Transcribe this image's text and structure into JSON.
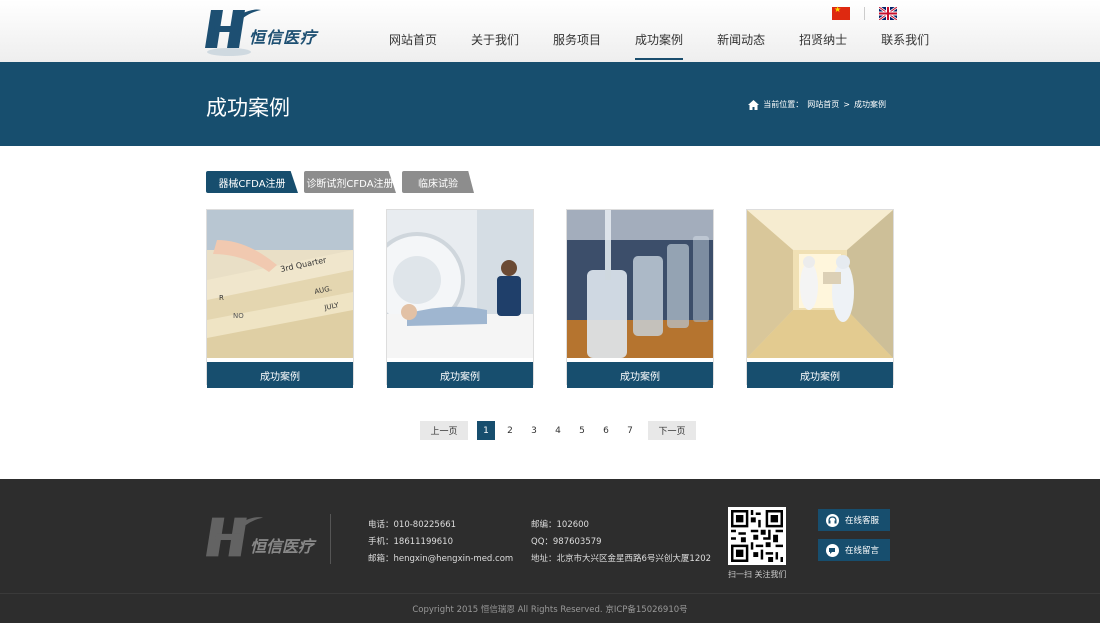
{
  "header": {
    "logo_text": "恒信医疗",
    "nav": [
      {
        "label": "网站首页"
      },
      {
        "label": "关于我们"
      },
      {
        "label": "服务项目"
      },
      {
        "label": "成功案例"
      },
      {
        "label": "新闻动态"
      },
      {
        "label": "招贤纳士"
      },
      {
        "label": "联系我们"
      }
    ],
    "active_nav": "成功案例"
  },
  "banner": {
    "title": "成功案例",
    "breadcrumb_prefix": "当前位置：",
    "breadcrumb_home": "网站首页",
    "breadcrumb_sep": ">",
    "breadcrumb_current": "成功案例"
  },
  "tabs": [
    {
      "label": "器械CFDA注册"
    },
    {
      "label": "诊断试剂CFDA注册"
    },
    {
      "label": "临床试验"
    }
  ],
  "cards": [
    {
      "caption": "成功案例"
    },
    {
      "caption": "成功案例"
    },
    {
      "caption": "成功案例"
    },
    {
      "caption": "成功案例"
    }
  ],
  "pager": {
    "prev": "上一页",
    "next": "下一页",
    "pages": [
      "1",
      "2",
      "3",
      "4",
      "5",
      "6",
      "7"
    ],
    "current": "1"
  },
  "footer": {
    "phone": "电话：010-80225661",
    "mobile": "手机：18611199610",
    "email": "邮箱：hengxin@hengxin-med.com",
    "postcode": "邮编：102600",
    "qq": "QQ：987603579",
    "address": "地址：北京市大兴区金星西路6号兴创大厦1202",
    "qr_caption": "扫一扫  关注我们",
    "service_online": "在线客服",
    "message_online": "在线留言",
    "copyright": "Copyright 2015 恒信瑞恩 All Rights Reserved. 京ICP备15026910号"
  },
  "colors": {
    "primary": "#174e6e",
    "footer_bg": "#2d2d2d"
  }
}
